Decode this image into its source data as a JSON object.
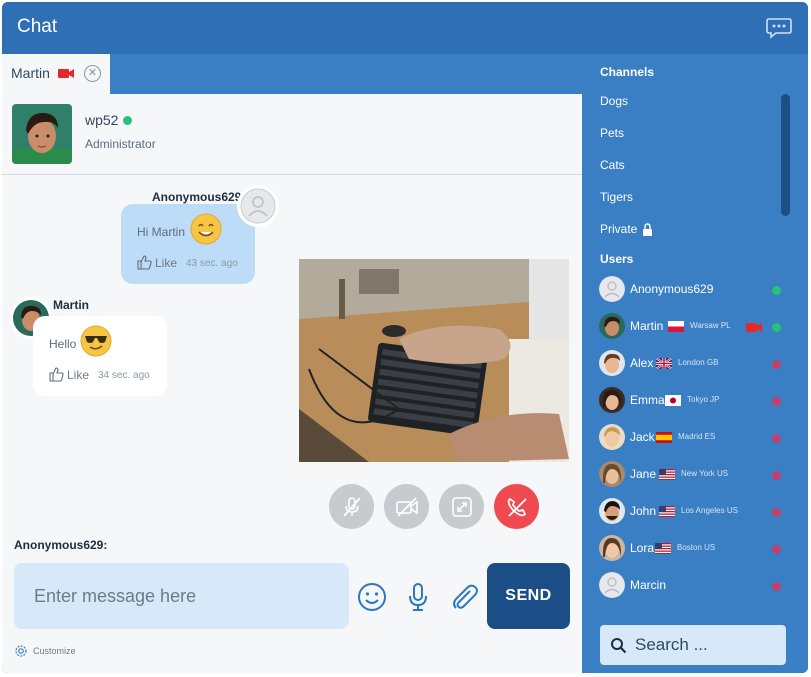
{
  "window": {
    "title": "Chat"
  },
  "tab": {
    "label": "Martin",
    "close_symbol": "✕"
  },
  "profile": {
    "username": "wp52",
    "role": "Administrator"
  },
  "messages": [
    {
      "author": "Anonymous629",
      "text": "Hi Martin",
      "like": "Like",
      "time": "43 sec. ago"
    },
    {
      "author": "Martin",
      "text": "Hello",
      "like": "Like",
      "time": "34 sec. ago"
    }
  ],
  "composer": {
    "sender_label": "Anonymous629:",
    "placeholder": "Enter message here",
    "send_label": "SEND",
    "customize_label": "Customize"
  },
  "sidebar": {
    "channels_title": "Channels",
    "channels": [
      "Dogs",
      "Pets",
      "Cats",
      "Tigers",
      "Private"
    ],
    "users_title": "Users",
    "users": [
      {
        "name": "Anonymous629",
        "location": "",
        "online": true
      },
      {
        "name": "Martin",
        "location": "Warsaw  PL",
        "online": true
      },
      {
        "name": "Alex",
        "location": "London  GB",
        "online": false
      },
      {
        "name": "Emma",
        "location": "Tokyo  JP",
        "online": false
      },
      {
        "name": "Jack",
        "location": "Madrid  ES",
        "online": false
      },
      {
        "name": "Jane",
        "location": "New York  US",
        "online": false
      },
      {
        "name": "John",
        "location": "Los Angeles  US",
        "online": false
      },
      {
        "name": "Lora",
        "location": "Boston  US",
        "online": false
      },
      {
        "name": "Marcin",
        "location": "",
        "online": false
      }
    ],
    "search_placeholder": "Search ..."
  },
  "colors": {
    "online": "#27c27a",
    "offline": "#c2416b",
    "accent": "#3a7ec4",
    "send": "#1b4e86",
    "hangup": "#ef4a50"
  }
}
